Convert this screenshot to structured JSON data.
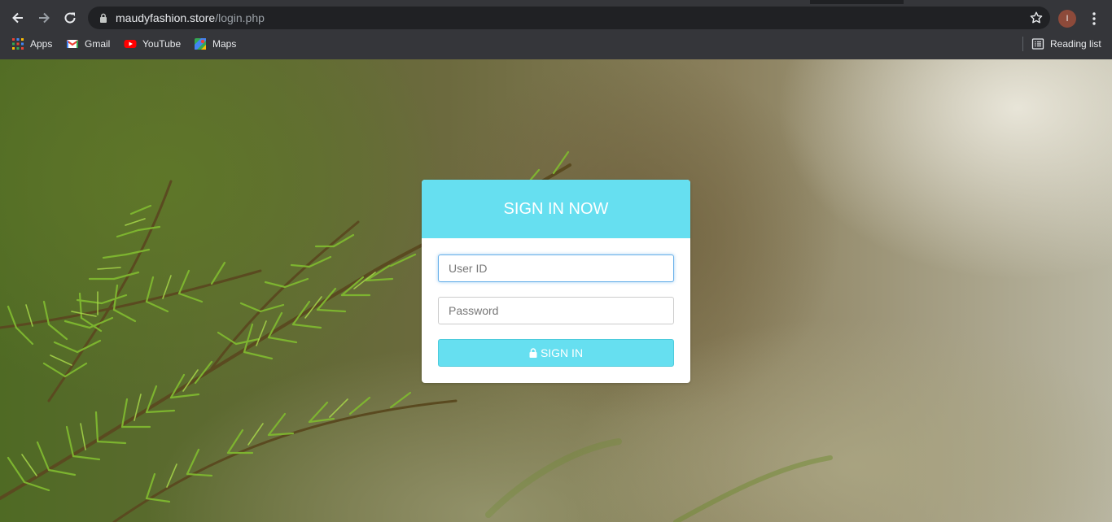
{
  "browser": {
    "url_host": "maudyfashion.store",
    "url_path": "/login.php",
    "profile_initial": "I",
    "bookmarks": [
      {
        "label": "Apps",
        "icon": "apps-grid-icon"
      },
      {
        "label": "Gmail",
        "icon": "gmail-icon"
      },
      {
        "label": "YouTube",
        "icon": "youtube-icon"
      },
      {
        "label": "Maps",
        "icon": "maps-icon"
      }
    ],
    "reading_list": "Reading list"
  },
  "login": {
    "title": "SIGN IN NOW",
    "user_placeholder": "User ID",
    "password_placeholder": "Password",
    "submit_label": "SIGN IN",
    "accent_color": "#66dff0"
  }
}
